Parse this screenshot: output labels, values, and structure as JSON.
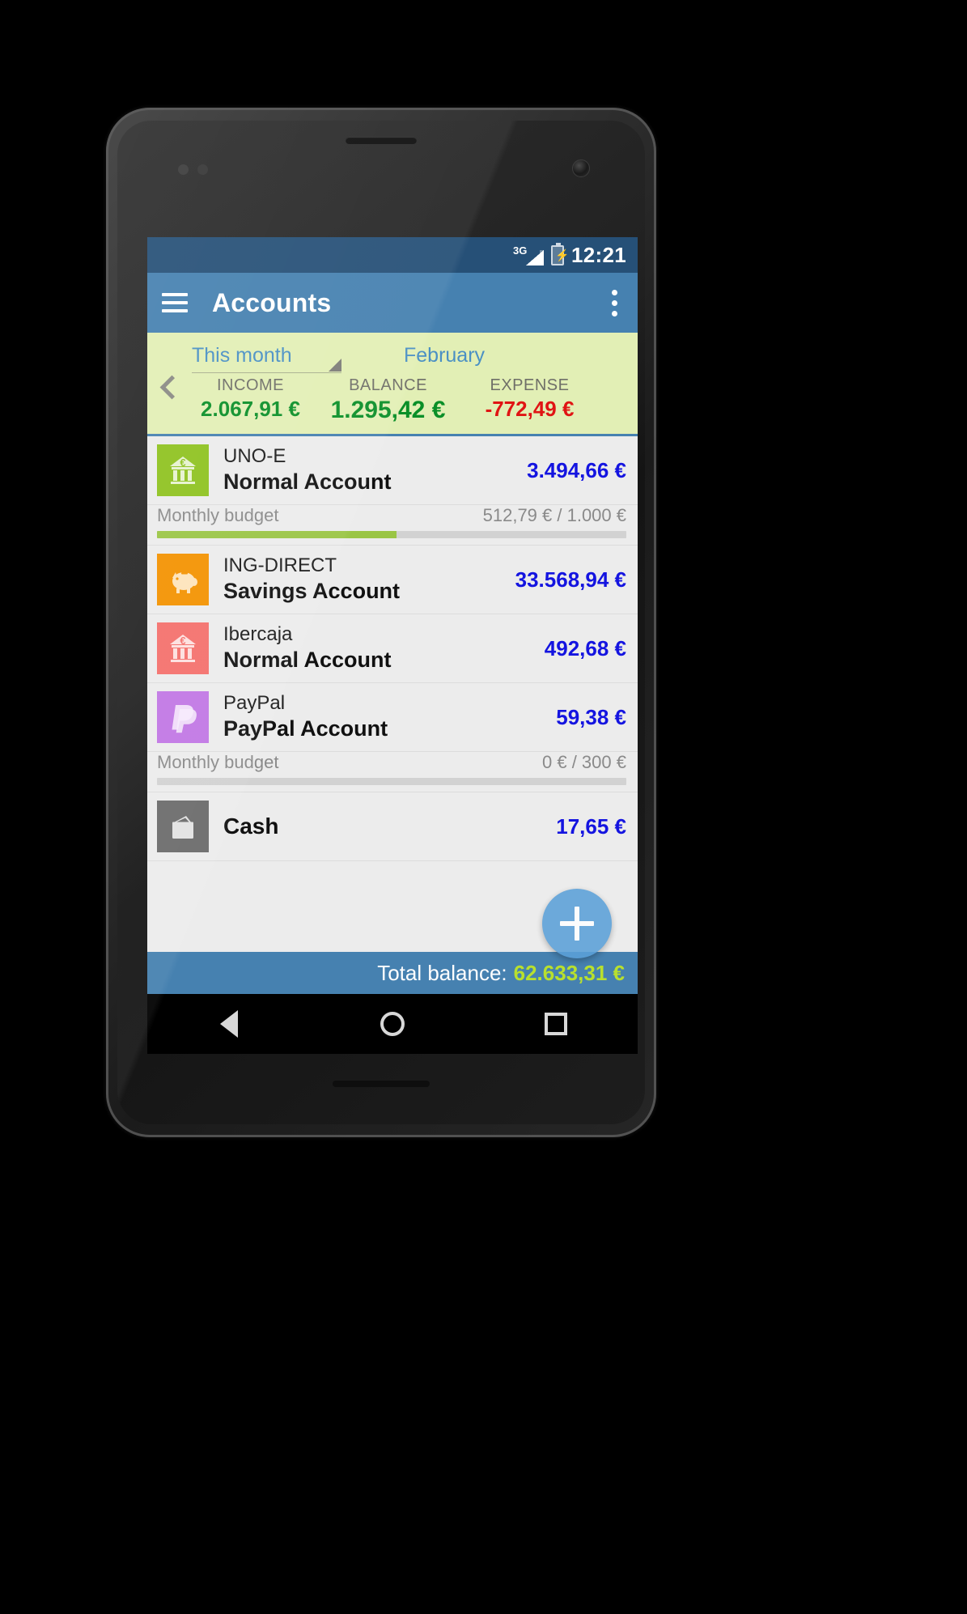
{
  "status_bar": {
    "network": "3G",
    "battery_icon": "battery-charging-icon",
    "clock": "12:21"
  },
  "app_bar": {
    "menu_icon": "hamburger-menu-icon",
    "title": "Accounts",
    "overflow_icon": "overflow-menu-icon"
  },
  "summary": {
    "prev_icon": "chevron-left-icon",
    "period": "This month",
    "period_caret_icon": "dropdown-caret-icon",
    "month": "February",
    "metrics": [
      {
        "label": "INCOME",
        "value": "2.067,91 €",
        "color": "#0a8f28"
      },
      {
        "label": "BALANCE",
        "value": "1.295,42 €",
        "color": "#0a8f28"
      },
      {
        "label": "EXPENSE",
        "value": "-772,49 €",
        "color": "#e01414"
      }
    ]
  },
  "accounts": [
    {
      "bank": "UNO-E",
      "type": "Normal Account",
      "amount": "3.494,66 €",
      "icon_name": "bank-euro-icon",
      "icon_bg": "#8ec21f",
      "budget": {
        "label": "Monthly budget",
        "value": "512,79 € / 1.000 €",
        "percent": 51
      }
    },
    {
      "bank": "ING-DIRECT",
      "type": "Savings Account",
      "amount": "33.568,94 €",
      "icon_name": "piggy-bank-icon",
      "icon_bg": "#f39200",
      "budget": null
    },
    {
      "bank": "Ibercaja",
      "type": "Normal Account",
      "amount": "492,68 €",
      "icon_name": "bank-euro-icon",
      "icon_bg": "#f4706c",
      "budget": null
    },
    {
      "bank": "PayPal",
      "type": "PayPal Account",
      "amount": "59,38 €",
      "icon_name": "paypal-icon",
      "icon_bg": "#c177e4",
      "budget": {
        "label": "Monthly budget",
        "value": "0 € / 300 €",
        "percent": 0
      }
    },
    {
      "bank": null,
      "type": "Cash",
      "amount": "17,65 €",
      "icon_name": "wallet-icon",
      "icon_bg": "#6b6b6b",
      "budget": null
    }
  ],
  "fab": {
    "icon": "plus-icon",
    "label": "add-account"
  },
  "total": {
    "label": "Total balance:",
    "value": "62.633,31 €"
  },
  "nav_bar": {
    "back": "back-triangle-icon",
    "home": "home-circle-icon",
    "recents": "recents-square-icon"
  }
}
